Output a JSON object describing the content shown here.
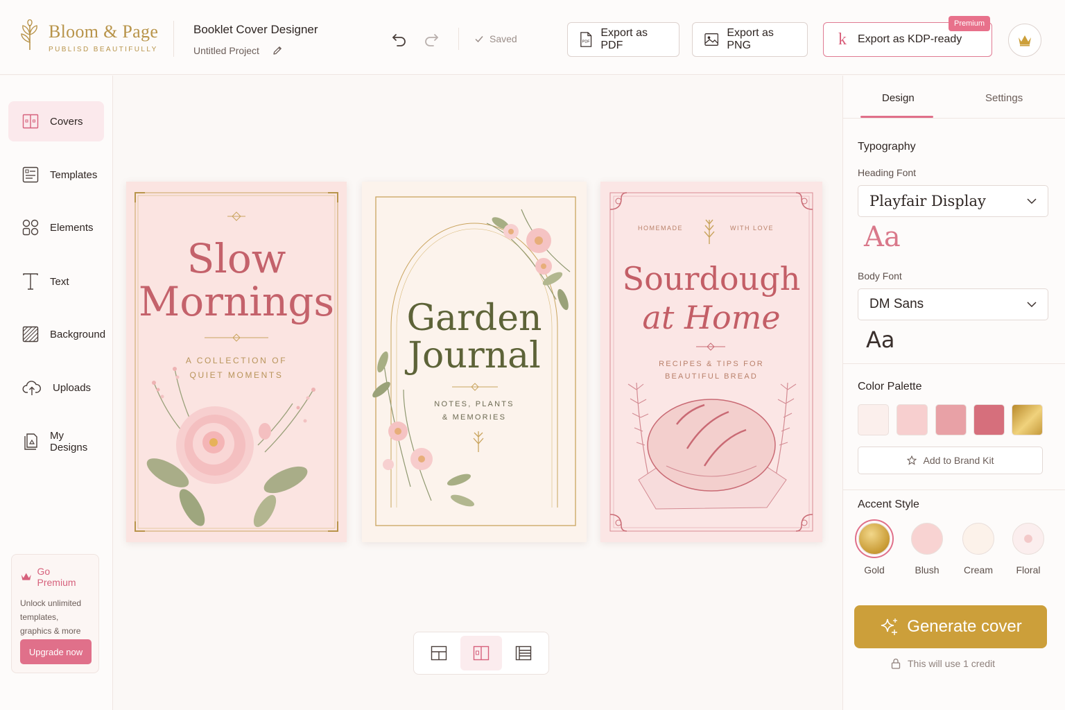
{
  "brand": {
    "name": "Bloom & Page",
    "tagline": "PUBLISD BEAUTIFULLY"
  },
  "project": {
    "app_title": "Booklet Cover Designer",
    "name": "Untitled Project"
  },
  "status": {
    "saved": "Saved"
  },
  "toolbar": {
    "export_pdf": "Export as PDF",
    "export_png": "Export as PNG",
    "export_kdp": "Export as KDP-ready",
    "kdp_glyph": "k",
    "premium_badge": "Premium",
    "pdf_icon_text": "PDF"
  },
  "sidebar": {
    "items": [
      {
        "label": "Covers",
        "icon": "covers-icon",
        "active": true
      },
      {
        "label": "Templates",
        "icon": "templates-icon"
      },
      {
        "label": "Elements",
        "icon": "elements-icon"
      },
      {
        "label": "Text",
        "icon": "text-icon"
      },
      {
        "label": "Background",
        "icon": "background-icon"
      },
      {
        "label": "Uploads",
        "icon": "upload-icon"
      },
      {
        "label": "My Designs",
        "icon": "my-designs-icon"
      }
    ],
    "premium": {
      "title": "Go Premium",
      "description": "Unlock unlimited templates, graphics & more",
      "button": "Upgrade now"
    }
  },
  "covers": [
    {
      "title_line1": "Slow",
      "title_line2": "Mornings",
      "subtitle_line1": "A COLLECTION OF",
      "subtitle_line2": "QUIET MOMENTS"
    },
    {
      "title_line1": "Garden",
      "title_line2": "Journal",
      "subtitle_line1": "NOTES, PLANTS",
      "subtitle_line2": "& MEMORIES"
    },
    {
      "top_left": "HOMEMADE",
      "top_right": "WITH LOVE",
      "title_line1": "Sourdough",
      "title_line2": "at Home",
      "subtitle_line1": "RECIPES & TIPS FOR",
      "subtitle_line2": "BEAUTIFUL BREAD"
    }
  ],
  "view_switch": {
    "active": "single"
  },
  "panel": {
    "tabs": [
      "Design",
      "Settings"
    ],
    "active_tab": "Design",
    "typography": {
      "title": "Typography",
      "heading_label": "Heading Font",
      "heading_font": "Playfair Display",
      "heading_sample": "Aa",
      "body_label": "Body Font",
      "body_font": "DM Sans",
      "body_sample": "Aa"
    },
    "palette": {
      "title": "Color Palette",
      "colors": [
        "#fbefec",
        "#f7cfcf",
        "#e8a1a6",
        "#d66f7c",
        "#d4aa3e"
      ],
      "brand_kit": "Add to Brand Kit"
    },
    "accent": {
      "title": "Accent Style",
      "options": [
        "Gold",
        "Blush",
        "Cream",
        "Floral"
      ],
      "selected": "Gold"
    },
    "generate": {
      "label": "Generate cover",
      "credit_note": "This will use 1 credit"
    }
  },
  "colors": {
    "accent_pink": "#e0708a",
    "gold": "#cc9f3a",
    "brand_gold": "#b8944a"
  }
}
